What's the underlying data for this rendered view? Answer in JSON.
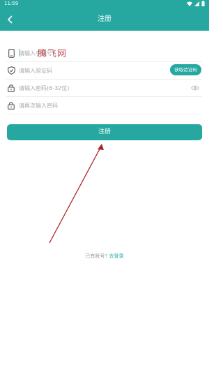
{
  "status_bar": {
    "time": "11:59"
  },
  "header": {
    "title": "注册",
    "back_icon": "back-arrow-icon"
  },
  "form": {
    "phone": {
      "placeholder": "请输入手机号",
      "icon": "phone-icon"
    },
    "code": {
      "placeholder": "请输入验证码",
      "icon": "shield-icon",
      "button_label": "获取验证码"
    },
    "password": {
      "placeholder": "请输入密码(6-32位)",
      "icon": "lock-icon",
      "toggle_icon": "eye-icon"
    },
    "confirm_password": {
      "placeholder": "请再次输入密码",
      "icon": "lock-icon"
    }
  },
  "watermark": "腾飞网",
  "register_button": {
    "label": "注册"
  },
  "footer": {
    "prompt": "已有账号?",
    "login_link": "去登录"
  },
  "colors": {
    "primary": "#26A8A0",
    "annotation": "#b0232a"
  }
}
